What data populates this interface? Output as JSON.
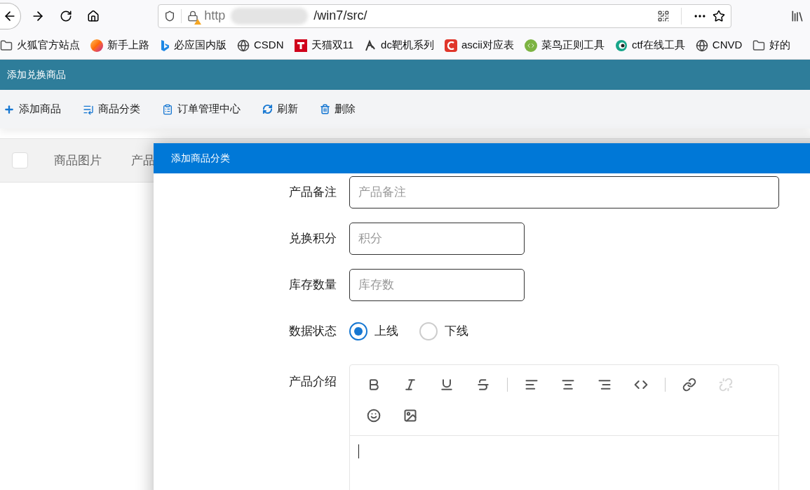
{
  "browser": {
    "url_start": "http",
    "url_end": "/win7/src/"
  },
  "bookmarks": [
    {
      "label": "火狐官方站点",
      "kind": "folder"
    },
    {
      "label": "新手上路",
      "kind": "firefox"
    },
    {
      "label": "必应国内版",
      "kind": "bing"
    },
    {
      "label": "CSDN",
      "kind": "globe"
    },
    {
      "label": "天猫双11",
      "kind": "tmall"
    },
    {
      "label": "dc靶机系列",
      "kind": "dc"
    },
    {
      "label": "ascii对应表",
      "kind": "c"
    },
    {
      "label": "菜鸟正则工具",
      "kind": "runoob"
    },
    {
      "label": "ctf在线工具",
      "kind": "ctf"
    },
    {
      "label": "CNVD",
      "kind": "globe"
    },
    {
      "label": "好的",
      "kind": "folder"
    }
  ],
  "app": {
    "title": "添加兑换商品",
    "actions": [
      {
        "label": "添加商品",
        "kind": "plus"
      },
      {
        "label": "商品分类",
        "kind": "list"
      },
      {
        "label": "订单管理中心",
        "kind": "clipboard"
      },
      {
        "label": "刷新",
        "kind": "refresh"
      },
      {
        "label": "删除",
        "kind": "trash"
      }
    ],
    "table": {
      "select_all": {
        "checked": false
      },
      "columns": [
        "商品图片",
        "产品"
      ]
    }
  },
  "dialog": {
    "title": "添加商品分类",
    "fields": [
      {
        "label": "产品备注",
        "placeholder": "产品备注",
        "kind": "wide"
      },
      {
        "label": "兑换积分",
        "placeholder": "积分",
        "kind": "short"
      },
      {
        "label": "库存数量",
        "placeholder": "库存数",
        "kind": "short"
      }
    ],
    "status": {
      "label": "数据状态",
      "options": [
        {
          "label": "上线",
          "selected": true
        },
        {
          "label": "下线",
          "selected": false
        }
      ]
    },
    "description": {
      "label": "产品介绍",
      "tools": [
        {
          "kind": "bold",
          "disabled": false
        },
        {
          "kind": "italic",
          "disabled": false
        },
        {
          "kind": "underline",
          "disabled": false
        },
        {
          "kind": "strike",
          "disabled": false
        },
        {
          "kind": "separator"
        },
        {
          "kind": "align-left",
          "disabled": false
        },
        {
          "kind": "align-center",
          "disabled": false
        },
        {
          "kind": "align-right",
          "disabled": false
        },
        {
          "kind": "code",
          "disabled": false
        },
        {
          "kind": "separator"
        },
        {
          "kind": "link",
          "disabled": false
        },
        {
          "kind": "unlink",
          "disabled": true
        },
        {
          "kind": "break"
        },
        {
          "kind": "emoji",
          "disabled": false
        },
        {
          "kind": "image",
          "disabled": false
        }
      ]
    }
  }
}
